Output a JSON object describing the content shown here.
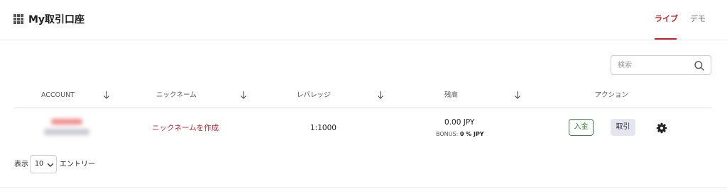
{
  "header": {
    "title": "My取引口座",
    "tabs": [
      {
        "label": "ライブ",
        "active": true
      },
      {
        "label": "デモ",
        "active": false
      }
    ]
  },
  "search": {
    "placeholder": "検索",
    "value": ""
  },
  "table": {
    "columns": [
      "ACCOUNT",
      "ニックネーム",
      "レバレッジ",
      "残高",
      "アクション"
    ],
    "rows": [
      {
        "account": "",
        "nickname": "ニックネームを作成",
        "leverage": "1:1000",
        "balance": "0.00 JPY",
        "bonus_label": "BONUS:",
        "bonus_value": "0 % JPY",
        "actions": {
          "deposit": "入金",
          "trade": "取引"
        }
      }
    ]
  },
  "footer": {
    "length_prefix": "表示",
    "length_value": "10",
    "length_suffix": "エントリー"
  },
  "colors": {
    "accent": "#c8232b",
    "deposit": "#3d8b40",
    "trade_bg": "#e4e5ee"
  },
  "icons": [
    "grid-icon",
    "search-icon",
    "sort-arrow-icon",
    "gear-icon",
    "chevron-down-icon"
  ]
}
